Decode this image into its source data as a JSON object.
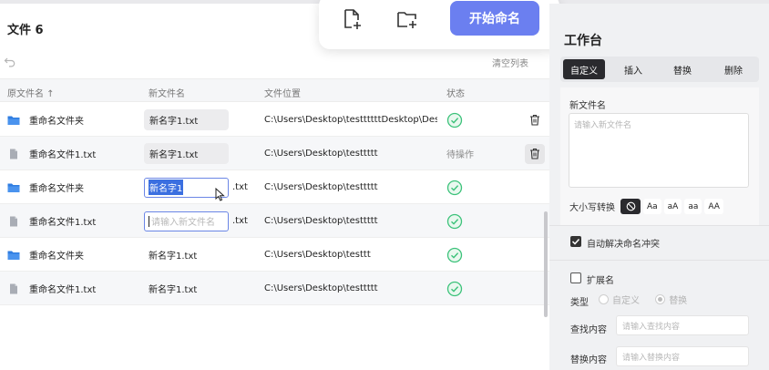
{
  "left": {
    "title": "文件 6",
    "clear_list": "清空列表",
    "columns": {
      "original": "原文件名 ↑",
      "new_name": "新文件名",
      "location": "文件位置",
      "status": "状态"
    },
    "rows": [
      {
        "icon": "folder-icon",
        "original": "重命名文件夹",
        "new_name": "新名字1.txt",
        "new_style": "chip",
        "ext": "",
        "path": "C:\\Users\\Desktop\\testtttttDesktop\\Des...",
        "status": "ok",
        "status_text": "",
        "action": "trash"
      },
      {
        "icon": "file-icon",
        "original": "重命名文件1.txt",
        "new_name": "新名字1.txt",
        "new_style": "chip",
        "ext": "",
        "path": "C:\\Users\\Desktop\\testtttt",
        "status": "pending",
        "status_text": "待操作",
        "action": "trash-hover"
      },
      {
        "icon": "folder-icon",
        "original": "重命名文件夹",
        "new_name": "新名字1",
        "new_style": "input-selected",
        "ext": ".txt",
        "path": "C:\\Users\\Desktop\\testtttt",
        "status": "ok",
        "status_text": "",
        "action": ""
      },
      {
        "icon": "file-icon",
        "original": "重命名文件1.txt",
        "new_name": "请输入新文件名",
        "new_style": "input-empty",
        "ext": ".txt",
        "path": "C:\\Users\\Desktop\\testtttt",
        "status": "ok",
        "status_text": "",
        "action": ""
      },
      {
        "icon": "folder-icon",
        "original": "重命名文件夹",
        "new_name": "新名字1.txt",
        "new_style": "plain",
        "ext": "",
        "path": "C:\\Users\\Desktop\\testtt",
        "status": "ok",
        "status_text": "",
        "action": ""
      },
      {
        "icon": "file-icon",
        "original": "重命名文件1.txt",
        "new_name": "新名字1.txt",
        "new_style": "plain",
        "ext": "",
        "path": "C:\\Users\\Desktop\\testtttt",
        "status": "ok",
        "status_text": "",
        "action": ""
      }
    ]
  },
  "toolbar": {
    "add_file_icon": "file-plus-icon",
    "add_folder_icon": "folder-plus-icon",
    "start_label": "开始命名"
  },
  "workspace": {
    "title": "工作台",
    "tabs": [
      "自定义",
      "插入",
      "替换",
      "删除"
    ],
    "active_tab": 0,
    "new_name_label": "新文件名",
    "new_name_placeholder": "请输入新文件名",
    "case_label": "大小写转换",
    "case_options": [
      "Aa",
      "aA",
      "aa",
      "AA"
    ],
    "auto_resolve_label": "自动解决命名冲突",
    "auto_resolve_checked": true,
    "extension_label": "扩展名",
    "extension_checked": false,
    "type_label": "类型",
    "type_options": [
      "自定义",
      "替换"
    ],
    "type_selected": 1,
    "find_label": "查找内容",
    "find_placeholder": "请输入查找内容",
    "replace_label": "替换内容",
    "replace_placeholder": "请输入替换内容"
  },
  "colors": {
    "accent": "#6b7ff0",
    "success": "#3cc27a",
    "dark_tab": "#2a2a2e",
    "folder": "#2f7de1"
  }
}
